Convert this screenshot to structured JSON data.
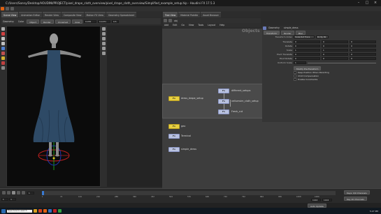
{
  "window": {
    "title": "C:/Users/Sonny/Desktop/HOUDINI/PROJECT/pixel_drape_cloth_overview/pixel_drape_cloth_overview/Simplified_example_setup.hip - Houdini FX 17.5.3"
  },
  "left_tabs": [
    "Scene View",
    "Animation Editor",
    "Render View",
    "Composite View",
    "Motion FX View",
    "Geometry Spreadsheet"
  ],
  "right_tabs": [
    "Tree View",
    "Material Palette",
    "Asset Browser"
  ],
  "viewport_toolbar": {
    "context": "Geometry",
    "shading": "Color",
    "mode_a": "Object",
    "mode_b": "Render",
    "camera": "Unnamed",
    "lights": "Area",
    "value1": "0.076",
    "value2": "0.1071",
    "value3": "0.5"
  },
  "network_tabs": [
    "/obj/dress_drape...",
    "obj",
    "Takes"
  ],
  "network_path": "obj",
  "network_menu": [
    "Add",
    "Edit",
    "Go",
    "View",
    "Tools",
    "Layout",
    "Help"
  ],
  "network_label": "Objects",
  "network_nodes": {
    "dress_drape_setup": "dress_drape_setup",
    "different_setups": "different_setups",
    "simulation": "vellumsim_cloth_setup",
    "final": "Fresh_cut",
    "geo": "geo",
    "geo2": "Terminal",
    "simple_dress": "simple_dress",
    "badge": "Fx"
  },
  "params": {
    "header_title": "Geometry",
    "node_name": "simple_dress",
    "tabs": [
      "Transform",
      "Render",
      "Misc"
    ],
    "rows": [
      {
        "label": "Transform Order",
        "values": [
          "Scale Rot Trans",
          "Rx Ry Rz"
        ]
      },
      {
        "label": "Translate",
        "values": [
          "0",
          "0",
          "0"
        ]
      },
      {
        "label": "Rotate",
        "values": [
          "0",
          "0",
          "0"
        ]
      },
      {
        "label": "Scale",
        "values": [
          "1",
          "1",
          "1"
        ]
      },
      {
        "label": "Pivot Translate",
        "values": [
          "0",
          "0",
          "0"
        ]
      },
      {
        "label": "Pivot Rotate",
        "values": [
          "0",
          "0",
          "0"
        ]
      },
      {
        "label": "Uniform Scale",
        "values": [
          "1"
        ]
      }
    ],
    "modify_label": "Modify Pre-Transform",
    "checks": [
      "Keep Position When Parenting",
      "Child Compensation",
      "Enable Constraints"
    ]
  },
  "timeline": {
    "frame": "1",
    "start": "1",
    "end": "1",
    "range_start": "1",
    "range_end": "1144",
    "total": "1144",
    "ticks": [
      "1",
      "72",
      "144",
      "216",
      "288",
      "360",
      "432",
      "504",
      "576",
      "648",
      "720",
      "792",
      "864",
      "936",
      "1008",
      "1080"
    ],
    "key_menu": "Keys: 0/0 Channels",
    "key_all": "Key All Channels",
    "realtime": "Auto Update"
  },
  "taskbar": {
    "time": "5:27 PM",
    "search_placeholder": "Type here to search"
  }
}
